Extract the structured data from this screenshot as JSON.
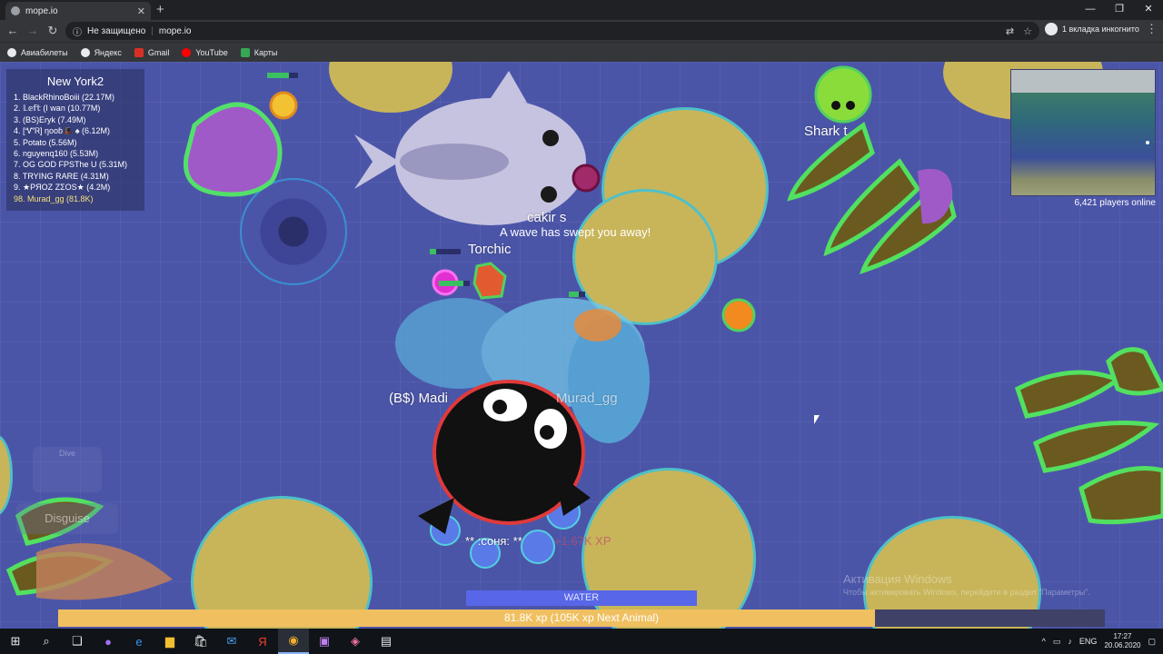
{
  "browser": {
    "tab_title": "mope.io",
    "security_label": "Не защищено",
    "url": "mope.io",
    "incognito_label": "1 вкладка инкогнито",
    "bookmarks": [
      {
        "label": "Авиабилеты",
        "color": "#e8eaed"
      },
      {
        "label": "Яндекс",
        "color": "#e8eaed"
      },
      {
        "label": "Gmail",
        "color": "#d93025"
      },
      {
        "label": "YouTube",
        "color": "#ff0000"
      },
      {
        "label": "Карты",
        "color": "#34a853"
      }
    ]
  },
  "game": {
    "leaderboard": {
      "server": "New York2",
      "rows": [
        "1. BlackRhinoBoiii (22.17M)",
        "2. 𝕃𝕖𝕗𝕥 (I wan (10.77M)",
        "3. (BS)Eryk (7.49M)",
        "4. [ᏉᏒ] ŋooɓ🎩 ♠ (6.12M)",
        "5. Potato (5.56M)",
        "6. nguyenq160 (5.53M)",
        "7. OG GOD FPSThe U (5.31M)",
        "8. TRYING RARE (4.31M)",
        "9. ★PЯOZ ZΣOS★ (4.2M)",
        "98. Murad_gg (81.8K)"
      ]
    },
    "players_online": "6,421 players online",
    "labels": {
      "shark": "Shark t",
      "cakir": "cakir s",
      "torchic": "Torchic",
      "madi": "(B$) Madi",
      "murad": "Murad_gg",
      "sonya": "** :соня: **"
    },
    "wave_message": "A wave has swept you away!",
    "xp_popup": "+1.67K XP",
    "zone": "WATER",
    "xp_bar_text": "81.8K xp  (105K xp Next Animal)",
    "xp_progress": 0.78,
    "dive_label": "Dive",
    "disguise_label": "Disguise",
    "activate_title": "Активация Windows",
    "activate_hint": "Чтобы активировать Windows, перейдите в раздел \"Параметры\".",
    "colors": {
      "water": "#4b55a8",
      "lake": "#c8b55a",
      "lake_border": "#4fc0c8",
      "xp_fill": "#f0c060",
      "zone_bar": "#5866e8"
    }
  },
  "taskbar": {
    "lang": "ENG",
    "time": "17:27",
    "date": "20.06.2020"
  }
}
